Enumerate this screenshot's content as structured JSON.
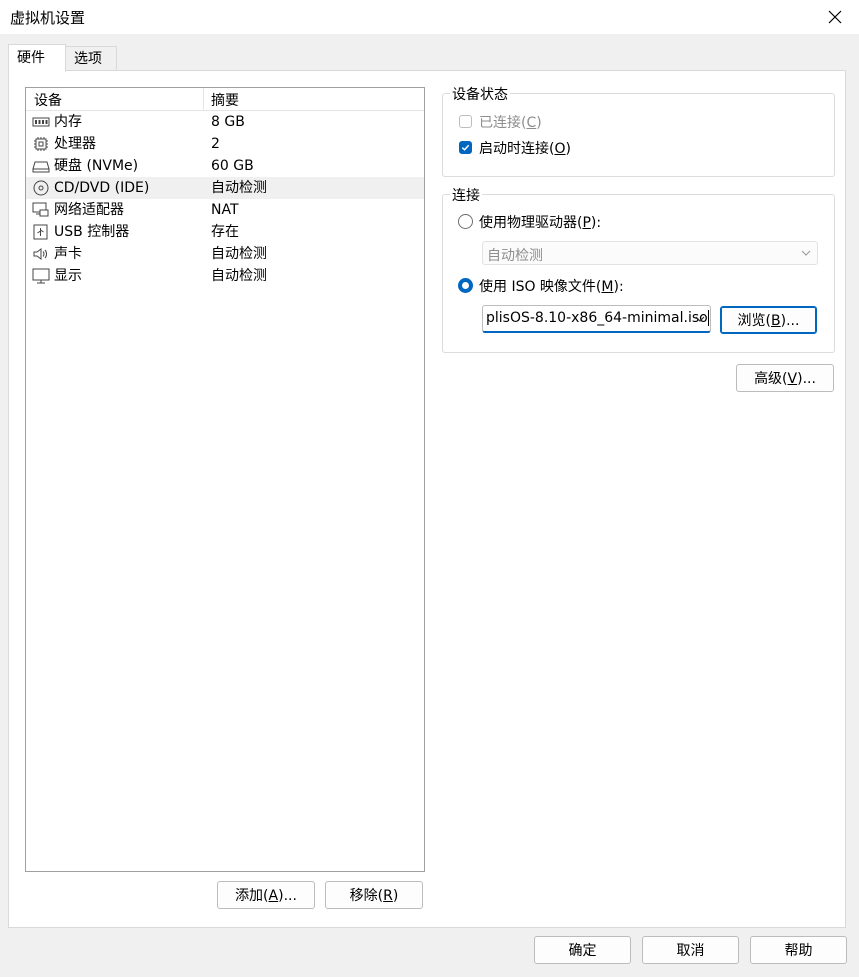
{
  "window": {
    "title": "虚拟机设置"
  },
  "tabs": [
    {
      "label": "硬件"
    },
    {
      "label": "选项"
    }
  ],
  "device_list": {
    "headers": {
      "device": "设备",
      "summary": "摘要"
    },
    "rows": [
      {
        "name": "内存",
        "summary": "8 GB",
        "icon": "memory-icon"
      },
      {
        "name": "处理器",
        "summary": "2",
        "icon": "cpu-icon"
      },
      {
        "name": "硬盘 (NVMe)",
        "summary": "60 GB",
        "icon": "hard-disk-icon"
      },
      {
        "name": "CD/DVD (IDE)",
        "summary": "自动检测",
        "icon": "cd-dvd-icon",
        "selected": true
      },
      {
        "name": "网络适配器",
        "summary": "NAT",
        "icon": "network-adapter-icon"
      },
      {
        "name": "USB 控制器",
        "summary": "存在",
        "icon": "usb-icon"
      },
      {
        "name": "声卡",
        "summary": "自动检测",
        "icon": "speaker-icon"
      },
      {
        "name": "显示",
        "summary": "自动检测",
        "icon": "monitor-icon"
      }
    ]
  },
  "list_buttons": {
    "add": {
      "text": "添加(",
      "key": "A",
      "suffix": ")..."
    },
    "remove": {
      "text": "移除(",
      "key": "R",
      "suffix": ")"
    }
  },
  "device_status": {
    "title": "设备状态",
    "connected": {
      "text": "已连接(",
      "key": "C",
      "suffix": ")",
      "checked": false,
      "enabled": false
    },
    "connect_at_power_on": {
      "text": "启动时连接(",
      "key": "O",
      "suffix": ")",
      "checked": true
    }
  },
  "connection": {
    "title": "连接",
    "physical_drive": {
      "text": "使用物理驱动器(",
      "key": "P",
      "suffix": "):",
      "selected": false
    },
    "physical_drive_value": "自动检测",
    "iso_image": {
      "text": "使用 ISO 映像文件(",
      "key": "M",
      "suffix": "):",
      "selected": true
    },
    "iso_path": "plisOS-8.10-x86_64-minimal.iso",
    "browse": {
      "text": "浏览(",
      "key": "B",
      "suffix": ")..."
    }
  },
  "advanced": {
    "text": "高级(",
    "key": "V",
    "suffix": ")..."
  },
  "footer": {
    "ok": "确定",
    "cancel": "取消",
    "help": "帮助"
  },
  "colors": {
    "accent": "#0067c0",
    "selected_row": "#f0f0f0",
    "panel": "#ffffff",
    "window_bg": "#f0f0f0"
  }
}
